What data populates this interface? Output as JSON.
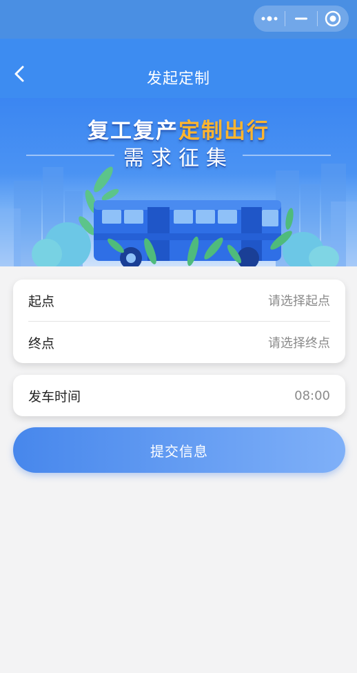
{
  "nav": {
    "title": "发起定制"
  },
  "banner": {
    "line1_part1": "复工复产",
    "line1_part2": "定制出行",
    "line2": "需求征集"
  },
  "route": {
    "start_label": "起点",
    "start_placeholder": "请选择起点",
    "end_label": "终点",
    "end_placeholder": "请选择终点"
  },
  "time": {
    "label": "发车时间",
    "value": "08:00"
  },
  "submit_label": "提交信息",
  "colors": {
    "nav": "#3d8cf1",
    "accent": "#ffb52e",
    "button_start": "#4787ec",
    "button_end": "#7fb0f8"
  }
}
